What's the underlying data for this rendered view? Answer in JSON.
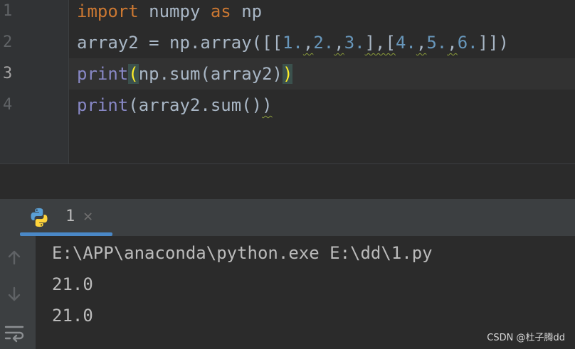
{
  "editor": {
    "line_numbers": [
      "1",
      "2",
      "3",
      "4"
    ],
    "line1": {
      "kw1": "import",
      "mid": " numpy ",
      "kw2": "as",
      "end": " np"
    },
    "line2": {
      "pre": "array2 = np.array([[",
      "n1": "1.",
      "c1": ",",
      "n2": "2.",
      "c2": ",",
      "n3": "3.",
      "mid": "],[",
      "n4": "4.",
      "c4": ",",
      "n5": "5.",
      "c5": ",",
      "n6": "6.",
      "end": "]])"
    },
    "line3": {
      "fn": "print",
      "open": "(",
      "mid": "np.sum(array2)",
      "close": ")"
    },
    "line4": {
      "fn": "print",
      "mid": "(array2.sum()",
      "close": ")"
    }
  },
  "run_panel": {
    "tab_label": "1",
    "close_glyph": "✕"
  },
  "console": {
    "lines": [
      "E:\\APP\\anaconda\\python.exe E:\\dd\\1.py",
      "21.0",
      "21.0"
    ]
  },
  "watermark": "CSDN @杜子腾dd",
  "colors": {
    "keyword": "#cc7832",
    "number": "#6897bb",
    "builtin": "#8888c6",
    "tab_underline": "#4a88c7"
  }
}
